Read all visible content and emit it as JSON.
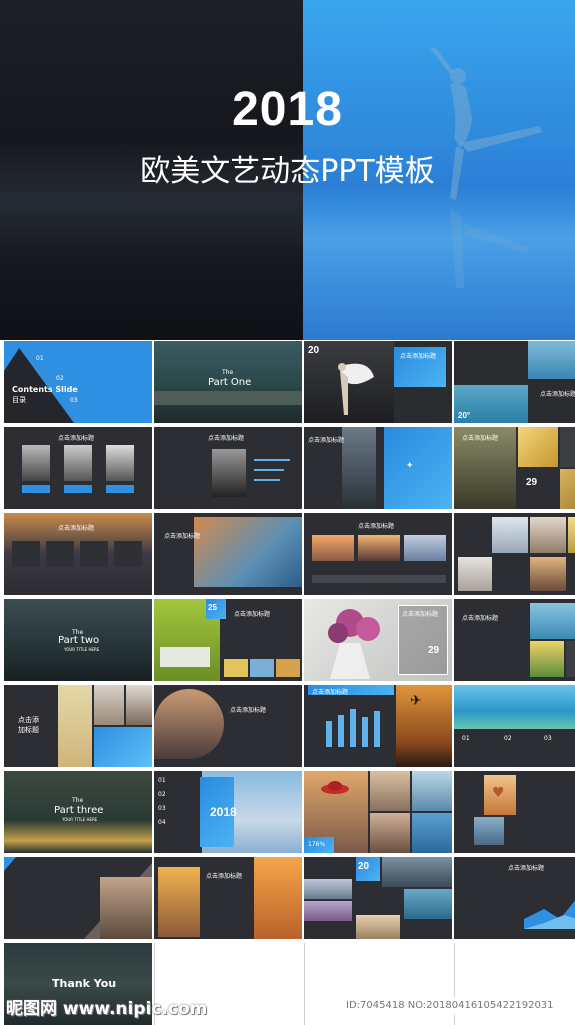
{
  "hero": {
    "year": "2018",
    "subtitle": "欧美文艺动态PPT模板"
  },
  "slides": {
    "contents_title": "Contents Slide",
    "contents_sub": "目录",
    "contents_items": [
      "01",
      "02",
      "03"
    ],
    "part_one_the": "The",
    "part_one": "Part One",
    "twenty": "20",
    "twenty_deg": "20°",
    "click_title": "点击添加标题",
    "click_title_short": "点击添\n加标题",
    "num_29": "29",
    "num_25": "25",
    "part_two_the": "The",
    "part_two": "Part two",
    "part_two_sub": "YOUR TITLE HERE",
    "part_three_the": "The",
    "part_three": "Part three",
    "part_three_sub": "YOUR TITLE HERE",
    "year2018": "2018",
    "nums": [
      "01",
      "02",
      "03",
      "04"
    ],
    "pct": "176%",
    "thank_you": "Thank You"
  },
  "watermark": {
    "left": "昵图网 www.nipic.com",
    "right": "ID:7045418 NO:20180416105422192031"
  }
}
